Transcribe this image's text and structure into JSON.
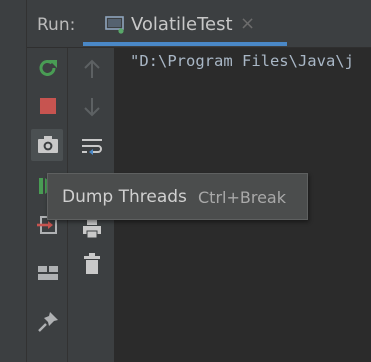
{
  "header": {
    "run_label": "Run:",
    "tab": {
      "label": "VolatileTest",
      "icon": "run-config-icon",
      "close_glyph": "×"
    }
  },
  "toolbar_primary": {
    "buttons": [
      {
        "name": "rerun-button",
        "icon": "rerun-icon",
        "color": "#499c54"
      },
      {
        "name": "stop-button",
        "icon": "stop-icon",
        "color": "#c75450"
      },
      {
        "name": "dump-threads-button",
        "icon": "camera-icon",
        "color": "#c9c9c9"
      },
      {
        "name": "resume-button",
        "icon": "resume-icon",
        "color": "#499c54"
      },
      {
        "name": "exit-button",
        "icon": "exit-icon",
        "color": "#afb1b3"
      },
      {
        "name": "restore-layout-button",
        "icon": "layout-icon",
        "color": "#afb1b3"
      },
      {
        "name": "pin-tab-button",
        "icon": "pin-icon",
        "color": "#afb1b3"
      }
    ]
  },
  "toolbar_secondary": {
    "buttons": [
      {
        "name": "up-stack-button",
        "icon": "arrow-up-icon"
      },
      {
        "name": "down-stack-button",
        "icon": "arrow-down-icon"
      },
      {
        "name": "soft-wrap-button",
        "icon": "soft-wrap-icon"
      },
      {
        "name": "print-button",
        "icon": "print-icon"
      },
      {
        "name": "clear-all-button",
        "icon": "trash-icon"
      }
    ]
  },
  "console": {
    "line": "\"D:\\Program Files\\Java\\j"
  },
  "tooltip": {
    "title": "Dump Threads",
    "shortcut": "Ctrl+Break"
  },
  "colors": {
    "background": "#2b2b2b",
    "panel": "#3c3f41",
    "accent": "#4a88c7",
    "tooltip_bg": "#4b4d4d"
  }
}
